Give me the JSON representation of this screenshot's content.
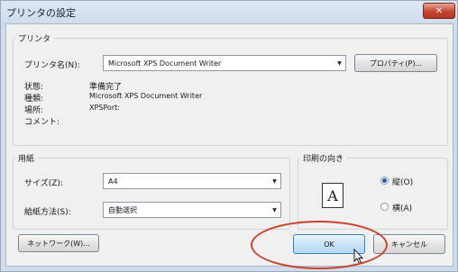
{
  "window": {
    "title": "プリンタの設定",
    "close_label": "✕"
  },
  "printer_group": {
    "legend": "プリンタ",
    "name_label": "プリンタ名(N):",
    "name_value": "Microsoft XPS Document Writer",
    "properties_button": "プロパティ(P)...",
    "status_label": "状態:",
    "status_value": "準備完了",
    "type_label": "種類:",
    "type_value": "Microsoft XPS Document Writer",
    "location_label": "場所:",
    "location_value": "XPSPort:",
    "comment_label": "コメント:"
  },
  "paper_group": {
    "legend": "用紙",
    "size_label": "サイズ(Z):",
    "size_value": "A4",
    "source_label": "給紙方法(S):",
    "source_value": "自動選択"
  },
  "orientation_group": {
    "legend": "印刷の向き",
    "preview_letter": "A",
    "portrait_label": "縦(O)",
    "landscape_label": "横(A)",
    "selected": "portrait"
  },
  "footer": {
    "network_button": "ネットワーク(W)...",
    "ok_button": "OK",
    "cancel_button": "キャンセル"
  },
  "colors": {
    "highlight_ellipse": "#c8432e",
    "accent": "#1f5fb5"
  }
}
